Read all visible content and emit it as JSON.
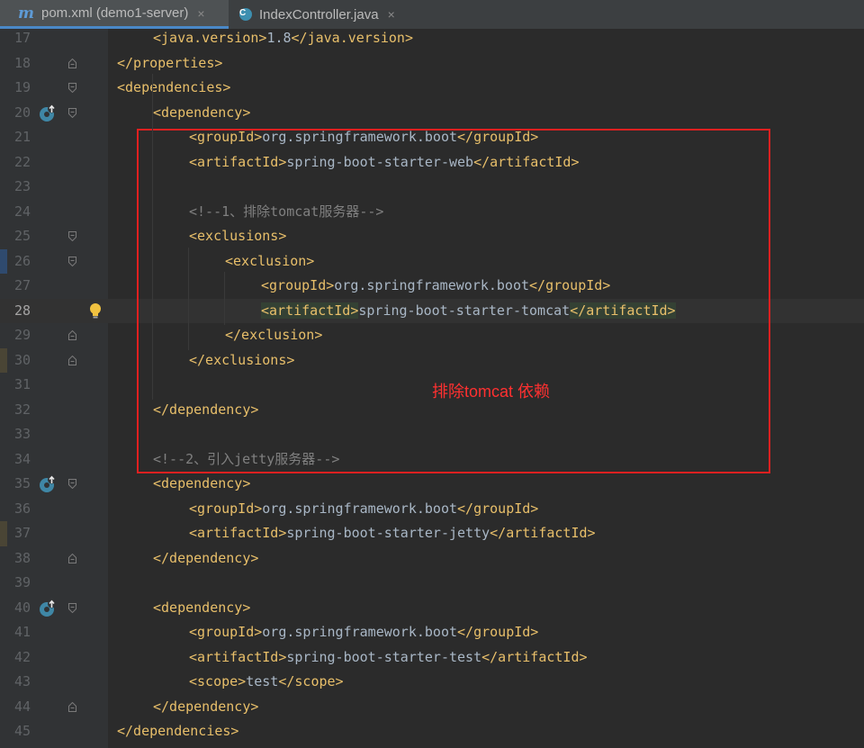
{
  "tabs": [
    {
      "label": "pom.xml (demo1-server)",
      "icon": "maven-m-icon",
      "active": true
    },
    {
      "label": "IndexController.java",
      "icon": "java-class-icon",
      "active": false
    }
  ],
  "tab_close_glyph": "×",
  "maven_glyph": "m",
  "class_glyph": "C",
  "lines": [
    {
      "n": "17",
      "text": "<java.version>1.8</java.version>"
    },
    {
      "n": "18",
      "text": "</properties>"
    },
    {
      "n": "19",
      "text": "<dependencies>"
    },
    {
      "n": "20",
      "text": "<dependency>"
    },
    {
      "n": "21",
      "text": "<groupId>org.springframework.boot</groupId>"
    },
    {
      "n": "22",
      "text": "<artifactId>spring-boot-starter-web</artifactId>"
    },
    {
      "n": "23",
      "text": ""
    },
    {
      "n": "24",
      "text": "<!--1、排除tomcat服务器-->"
    },
    {
      "n": "25",
      "text": "<exclusions>"
    },
    {
      "n": "26",
      "text": "<exclusion>"
    },
    {
      "n": "27",
      "text": "<groupId>org.springframework.boot</groupId>"
    },
    {
      "n": "28",
      "text": "<artifactId>spring-boot-starter-tomcat</artifactId>"
    },
    {
      "n": "29",
      "text": "</exclusion>"
    },
    {
      "n": "30",
      "text": "</exclusions>"
    },
    {
      "n": "31",
      "text": ""
    },
    {
      "n": "32",
      "text": "</dependency>"
    },
    {
      "n": "33",
      "text": ""
    },
    {
      "n": "34",
      "text": "<!--2、引入jetty服务器-->"
    },
    {
      "n": "35",
      "text": "<dependency>"
    },
    {
      "n": "36",
      "text": "<groupId>org.springframework.boot</groupId>"
    },
    {
      "n": "37",
      "text": "<artifactId>spring-boot-starter-jetty</artifactId>"
    },
    {
      "n": "38",
      "text": "</dependency>"
    },
    {
      "n": "39",
      "text": ""
    },
    {
      "n": "40",
      "text": "<dependency>"
    },
    {
      "n": "41",
      "text": "<groupId>org.springframework.boot</groupId>"
    },
    {
      "n": "42",
      "text": "<artifactId>spring-boot-starter-test</artifactId>"
    },
    {
      "n": "43",
      "text": "<scope>test</scope>"
    },
    {
      "n": "44",
      "text": "</dependency>"
    },
    {
      "n": "45",
      "text": "</dependencies>"
    }
  ],
  "current_line": "28",
  "annotation": "排除tomcat 依赖",
  "colors": {
    "tag": "#e8bf6a",
    "text": "#a9b7c6",
    "comment": "#808080",
    "highlight_box": "#e02020"
  }
}
